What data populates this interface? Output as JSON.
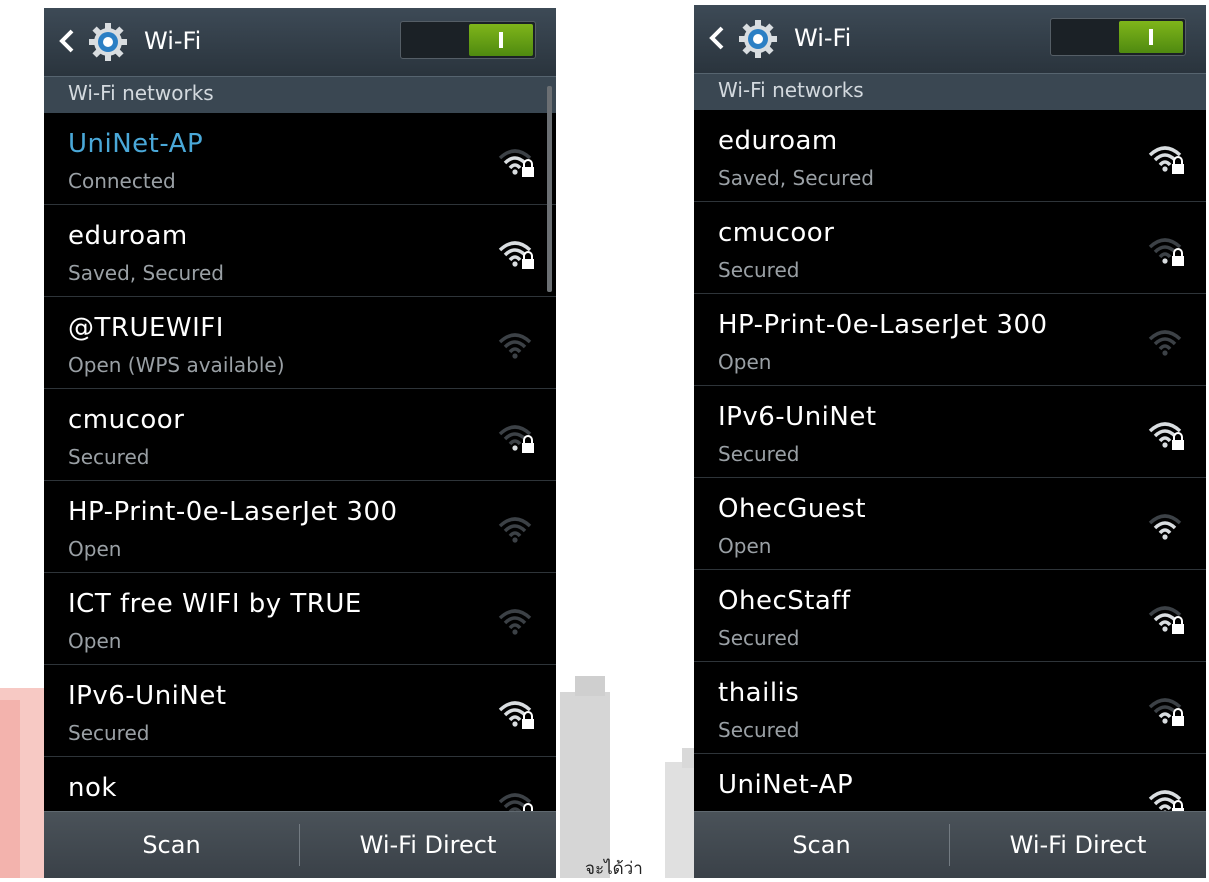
{
  "caption": "จะได้ว่า",
  "colors": {
    "connected_ssid": "#4aa8d8",
    "toggle_on": "#6aa614",
    "actionbar": "#36414b"
  },
  "screens": [
    {
      "back_icon": "chevron-left-icon",
      "settings_icon": "gear-icon",
      "title": "Wi-Fi",
      "toggle_state": "on",
      "section_header": "Wi-Fi networks",
      "networks": [
        {
          "ssid": "UniNet-AP",
          "status": "Connected",
          "connected": true,
          "signal_bars": 3,
          "secured": true
        },
        {
          "ssid": "eduroam",
          "status": "Saved, Secured",
          "connected": false,
          "signal_bars": 4,
          "secured": true
        },
        {
          "ssid": "@TRUEWIFI",
          "status": "Open (WPS available)",
          "connected": false,
          "signal_bars": 0,
          "secured": false
        },
        {
          "ssid": "cmucoor",
          "status": "Secured",
          "connected": false,
          "signal_bars": 1,
          "secured": true
        },
        {
          "ssid": "HP-Print-0e-LaserJet 300",
          "status": "Open",
          "connected": false,
          "signal_bars": 0,
          "secured": false
        },
        {
          "ssid": "ICT free WIFI by TRUE",
          "status": "Open",
          "connected": false,
          "signal_bars": 0,
          "secured": false
        },
        {
          "ssid": "IPv6-UniNet",
          "status": "Secured",
          "connected": false,
          "signal_bars": 4,
          "secured": true
        },
        {
          "ssid": "nok",
          "status": "",
          "connected": false,
          "signal_bars": 1,
          "secured": true
        }
      ],
      "buttons": {
        "scan": "Scan",
        "wifi_direct": "Wi-Fi Direct"
      }
    },
    {
      "back_icon": "chevron-left-icon",
      "settings_icon": "gear-icon",
      "title": "Wi-Fi",
      "toggle_state": "on",
      "section_header": "Wi-Fi networks",
      "networks": [
        {
          "ssid": "eduroam",
          "status": "Saved, Secured",
          "connected": false,
          "signal_bars": 4,
          "secured": true
        },
        {
          "ssid": "cmucoor",
          "status": "Secured",
          "connected": false,
          "signal_bars": 1,
          "secured": true
        },
        {
          "ssid": "HP-Print-0e-LaserJet 300",
          "status": "Open",
          "connected": false,
          "signal_bars": 0,
          "secured": false
        },
        {
          "ssid": "IPv6-UniNet",
          "status": "Secured",
          "connected": false,
          "signal_bars": 4,
          "secured": true
        },
        {
          "ssid": "OhecGuest",
          "status": "Open",
          "connected": false,
          "signal_bars": 3,
          "secured": false
        },
        {
          "ssid": "OhecStaff",
          "status": "Secured",
          "connected": false,
          "signal_bars": 3,
          "secured": true
        },
        {
          "ssid": "thailis",
          "status": "Secured",
          "connected": false,
          "signal_bars": 2,
          "secured": true
        },
        {
          "ssid": "UniNet-AP",
          "status": "",
          "connected": false,
          "signal_bars": 4,
          "secured": true
        }
      ],
      "buttons": {
        "scan": "Scan",
        "wifi_direct": "Wi-Fi Direct"
      }
    }
  ]
}
